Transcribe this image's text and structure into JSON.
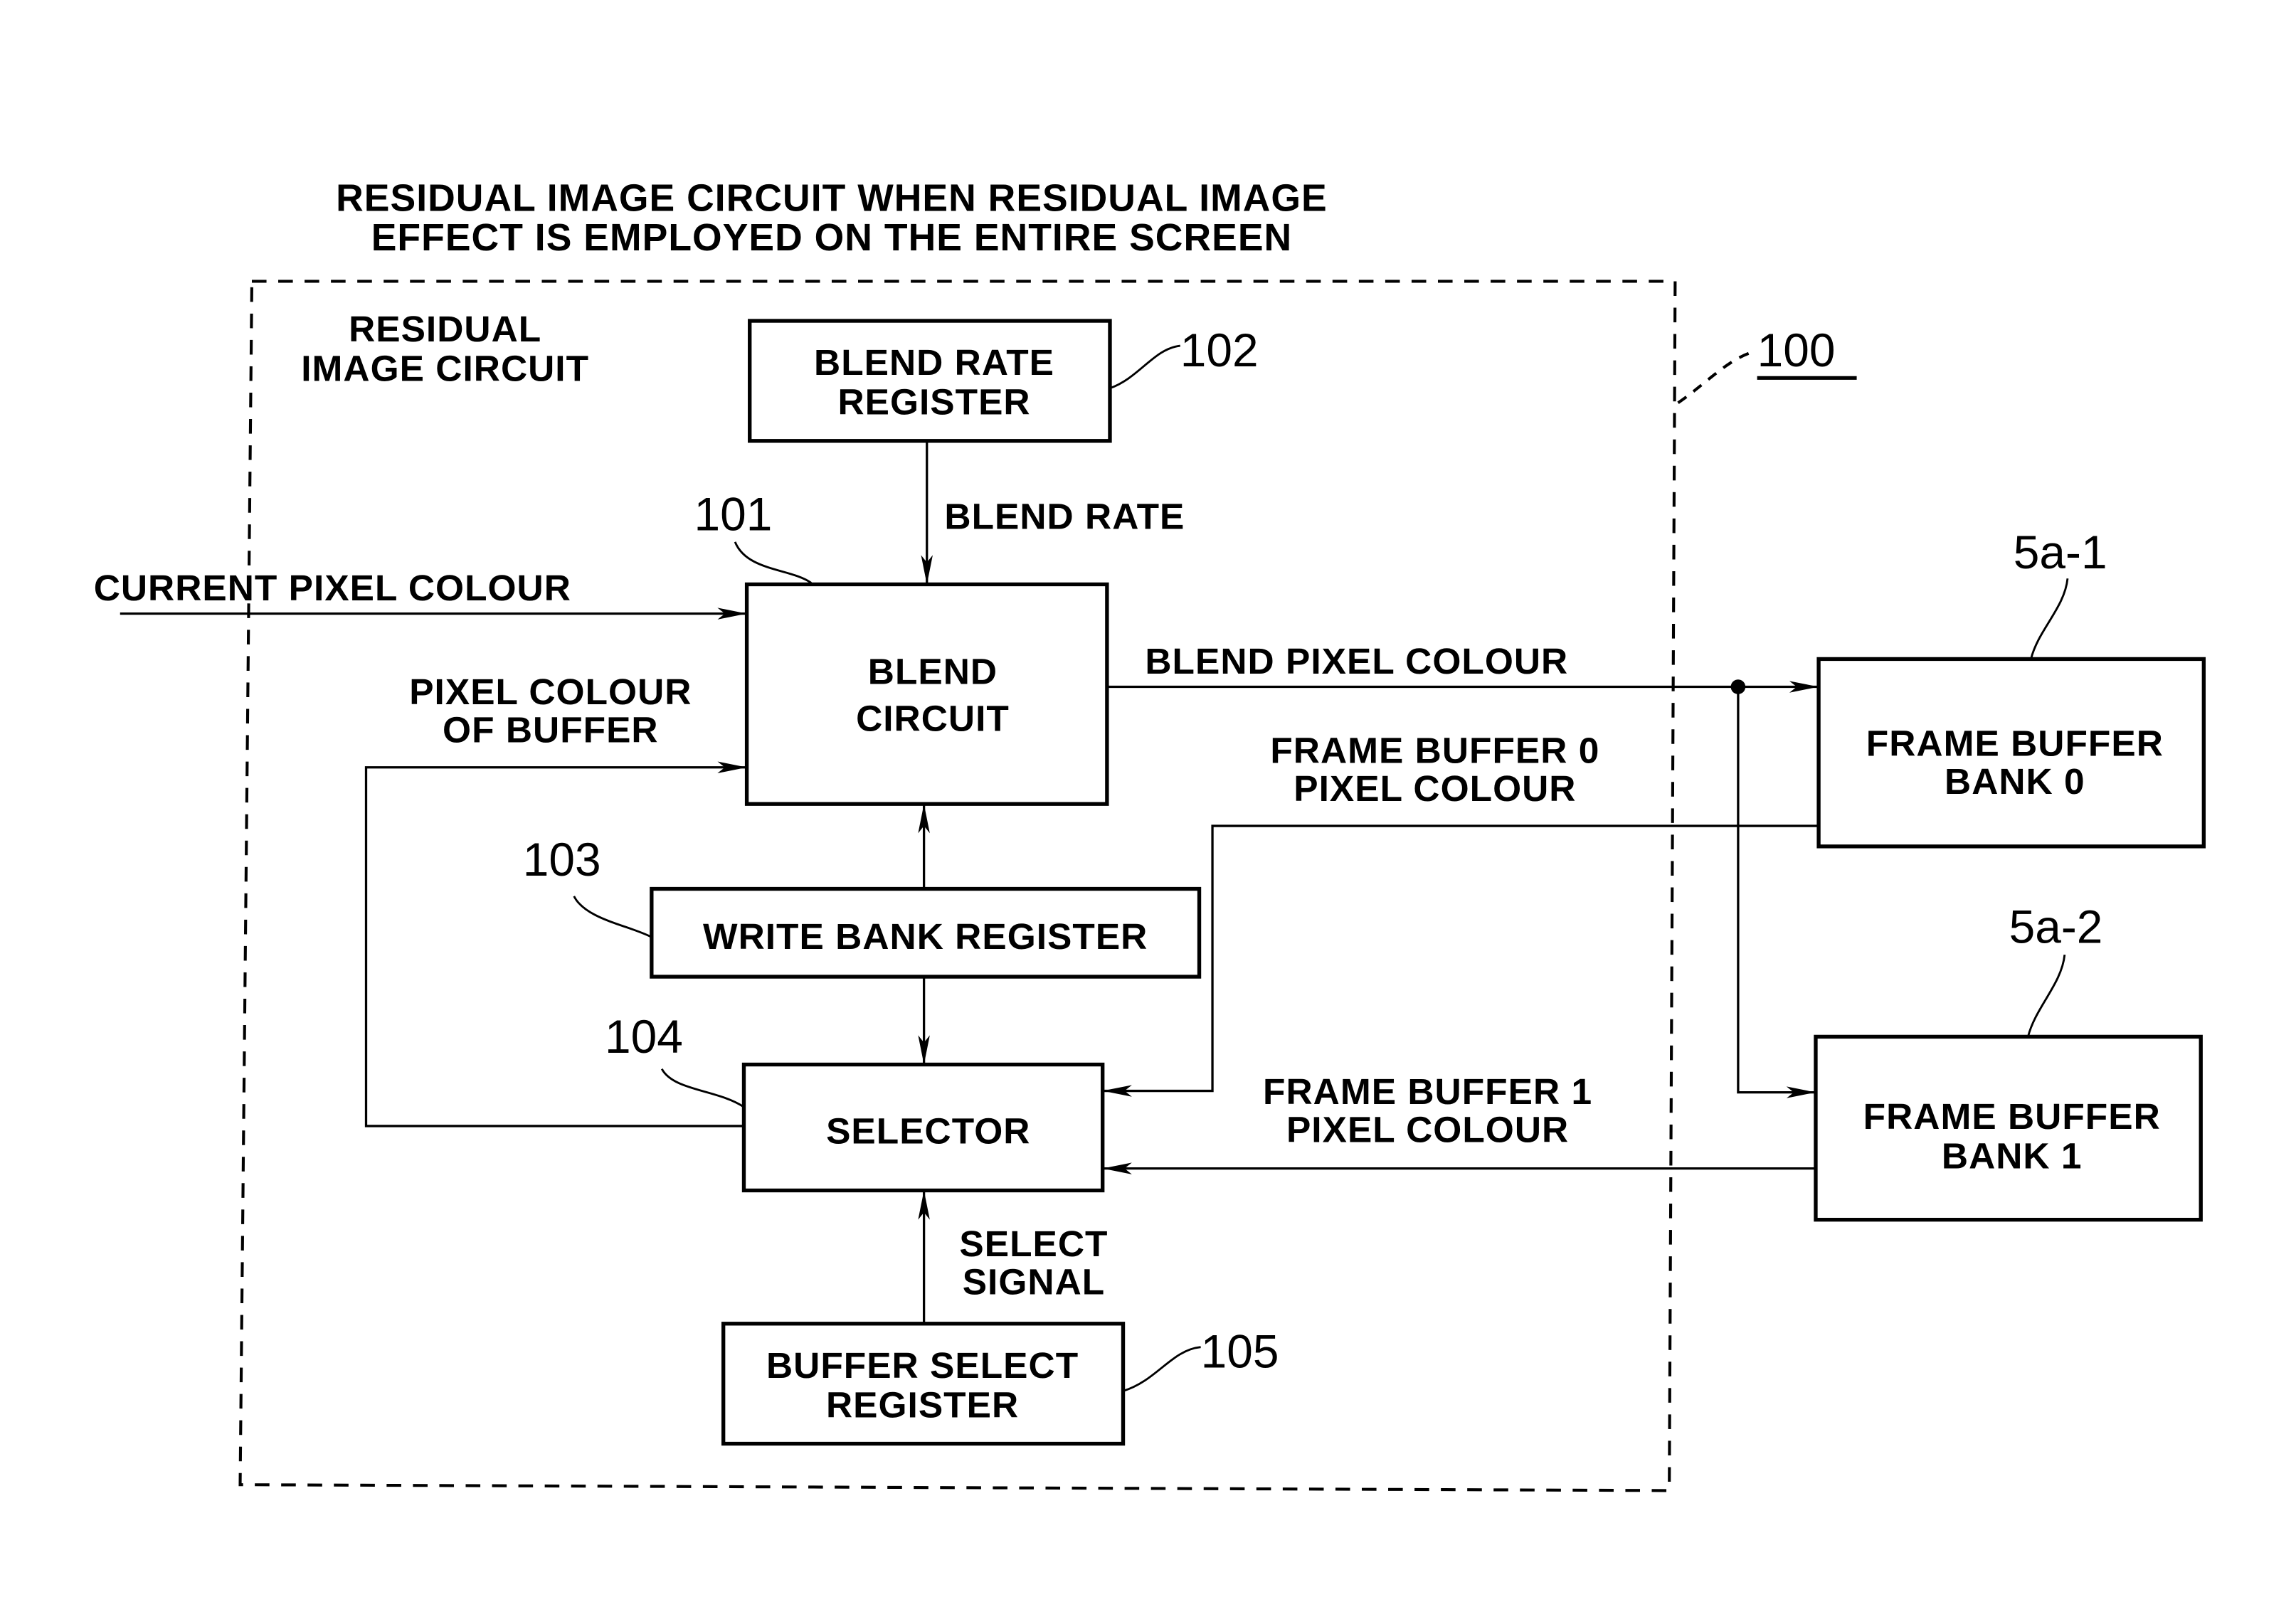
{
  "diagram": {
    "title_line1": "RESIDUAL IMAGE CIRCUIT WHEN RESIDUAL IMAGE",
    "title_line2": "EFFECT IS EMPLOYED ON THE ENTIRE SCREEN",
    "region": {
      "label_line1": "RESIDUAL",
      "label_line2": "IMAGE CIRCUIT",
      "ref": "100"
    },
    "blocks": {
      "blend_rate_register": {
        "line1": "BLEND RATE",
        "line2": "REGISTER",
        "ref": "102"
      },
      "blend_circuit": {
        "line1": "BLEND",
        "line2": "CIRCUIT",
        "ref": "101"
      },
      "write_bank_register": {
        "line1": "WRITE BANK REGISTER",
        "ref": "103"
      },
      "selector": {
        "line1": "SELECTOR",
        "ref": "104"
      },
      "buffer_select_register": {
        "line1": "BUFFER SELECT",
        "line2": "REGISTER",
        "ref": "105"
      },
      "frame_buffer_bank0": {
        "line1": "FRAME BUFFER",
        "line2": "BANK 0",
        "ref": "5a-1"
      },
      "frame_buffer_bank1": {
        "line1": "FRAME BUFFER",
        "line2": "BANK 1",
        "ref": "5a-2"
      }
    },
    "signals": {
      "blend_rate": "BLEND RATE",
      "current_pixel_colour": "CURRENT PIXEL COLOUR",
      "pixel_colour_of_buffer_line1": "PIXEL COLOUR",
      "pixel_colour_of_buffer_line2": "OF BUFFER",
      "blend_pixel_colour": "BLEND PIXEL COLOUR",
      "fb0_pixel_colour_line1": "FRAME BUFFER 0",
      "fb0_pixel_colour_line2": "PIXEL COLOUR",
      "fb1_pixel_colour_line1": "FRAME BUFFER 1",
      "fb1_pixel_colour_line2": "PIXEL COLOUR",
      "select_signal_line1": "SELECT",
      "select_signal_line2": "SIGNAL"
    }
  }
}
